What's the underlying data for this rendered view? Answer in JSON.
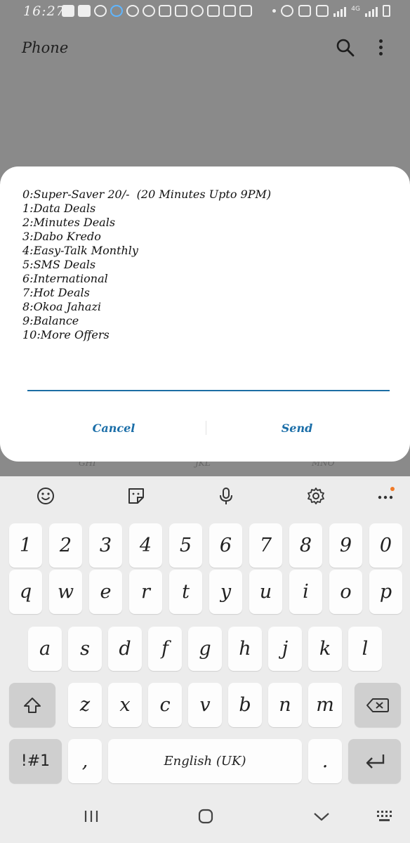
{
  "status_bar": {
    "time": "16:27",
    "network": "4G"
  },
  "app": {
    "title": "Phone",
    "search_icon": "search-icon",
    "more_icon": "more-vert-icon"
  },
  "dialog": {
    "lines": [
      "0:Super-Saver 20/-  (20 Minutes Upto 9PM)",
      "1:Data Deals",
      "2:Minutes Deals",
      "3:Dabo Kredo",
      "4:Easy-Talk Monthly",
      "5:SMS Deals",
      "6:International",
      "7:Hot Deals",
      "8:Okoa Jahazi",
      "9:Balance",
      "10:More Offers"
    ],
    "input_value": "",
    "cancel_label": "Cancel",
    "send_label": "Send",
    "accent_color": "#1b6ea8"
  },
  "background_peek": [
    "GHI",
    "JKL",
    "MNO"
  ],
  "keyboard": {
    "toolbar_icons": [
      "emoji-icon",
      "sticker-icon",
      "microphone-icon",
      "settings-icon",
      "more-horiz-icon"
    ],
    "row_numbers": [
      "1",
      "2",
      "3",
      "4",
      "5",
      "6",
      "7",
      "8",
      "9",
      "0"
    ],
    "row_top": [
      "q",
      "w",
      "e",
      "r",
      "t",
      "y",
      "u",
      "i",
      "o",
      "p"
    ],
    "row_middle": [
      "a",
      "s",
      "d",
      "f",
      "g",
      "h",
      "j",
      "k",
      "l"
    ],
    "row_bottom": [
      "z",
      "x",
      "c",
      "v",
      "b",
      "n",
      "m"
    ],
    "symbols_label": "!#1",
    "comma_label": ",",
    "space_label": "English (UK)",
    "period_label": ".",
    "shift_icon": "shift-icon",
    "backspace_icon": "backspace-icon",
    "enter_icon": "enter-icon"
  },
  "navbar": {
    "icons": [
      "recents-icon",
      "home-icon",
      "back-icon",
      "keyboard-switch-icon"
    ]
  }
}
